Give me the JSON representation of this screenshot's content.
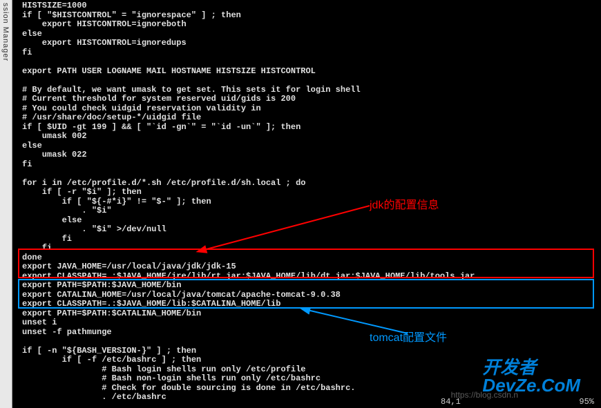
{
  "sidebar": {
    "label": "ssion Manager"
  },
  "terminal": {
    "lines": [
      "HISTSIZE=1000",
      "if [ \"$HISTCONTROL\" = \"ignorespace\" ] ; then",
      "    export HISTCONTROL=ignoreboth",
      "else",
      "    export HISTCONTROL=ignoredups",
      "fi",
      "",
      "export PATH USER LOGNAME MAIL HOSTNAME HISTSIZE HISTCONTROL",
      "",
      "# By default, we want umask to get set. This sets it for login shell",
      "# Current threshold for system reserved uid/gids is 200",
      "# You could check uidgid reservation validity in",
      "# /usr/share/doc/setup-*/uidgid file",
      "if [ $UID -gt 199 ] && [ \"`id -gn`\" = \"`id -un`\" ]; then",
      "    umask 002",
      "else",
      "    umask 022",
      "fi",
      "",
      "for i in /etc/profile.d/*.sh /etc/profile.d/sh.local ; do",
      "    if [ -r \"$i\" ]; then",
      "        if [ \"${-#*i}\" != \"$-\" ]; then",
      "            . \"$i\"",
      "        else",
      "            . \"$i\" >/dev/null",
      "        fi",
      "    fi",
      "done",
      "export JAVA_HOME=/usr/local/java/jdk/jdk-15",
      "export CLASSPATH=.:$JAVA_HOME/jre/lib/rt.jar:$JAVA_HOME/lib/dt.jar:$JAVA_HOME/lib/tools.jar",
      "export PATH=$PATH:$JAVA_HOME/bin",
      "export CATALINA_HOME=/usr/local/java/tomcat/apache-tomcat-9.0.38",
      "export CLASSPATH=.:$JAVA_HOME/lib:$CATALINA_HOME/lib",
      "export PATH=$PATH:$CATALINA_HOME/bin",
      "unset i",
      "unset -f pathmunge",
      "",
      "if [ -n \"${BASH_VERSION-}\" ] ; then",
      "        if [ -f /etc/bashrc ] ; then",
      "                # Bash login shells run only /etc/profile",
      "                # Bash non-login shells run only /etc/bashrc",
      "                # Check for double sourcing is done in /etc/bashrc.",
      "                . /etc/bashrc"
    ]
  },
  "annotations": {
    "jdk": "jdk的配置信息",
    "tomcat": "tomcat配置文件"
  },
  "watermark": {
    "brand": "开发者\nDevZe.CoM",
    "url": "https://blog.csdn.n"
  },
  "status": {
    "position": "84,1",
    "percent": "95%"
  }
}
